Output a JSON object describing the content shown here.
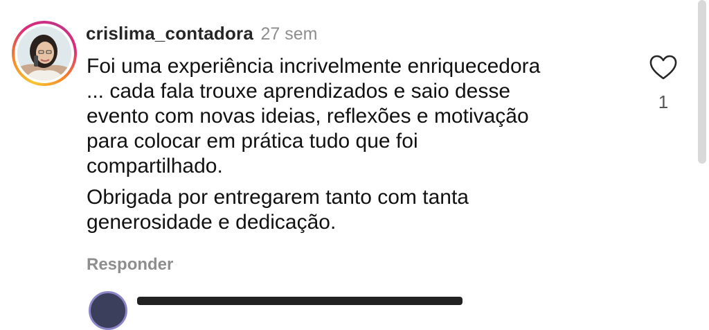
{
  "comment": {
    "username": "crislima_contadora",
    "timestamp": "27 sem",
    "paragraphs": [
      "Foi uma experiência incrivelmente enriquecedora\n... cada fala trouxe aprendizados e saio desse\nevento com novas ideias, reflexões e motivação\npara colocar em prática tudo que foi\ncompartilhado.",
      "Obrigada por entregarem tanto com tanta\ngenerosidade e dedicação."
    ],
    "reply_label": "Responder",
    "like_count": "1",
    "icons": {
      "like": "heart-outline-icon"
    }
  },
  "colors": {
    "username": "#262626",
    "muted": "#8e8e8e",
    "story_ring": [
      "#f9c631",
      "#f58529",
      "#dd2a7b",
      "#c13584"
    ]
  }
}
